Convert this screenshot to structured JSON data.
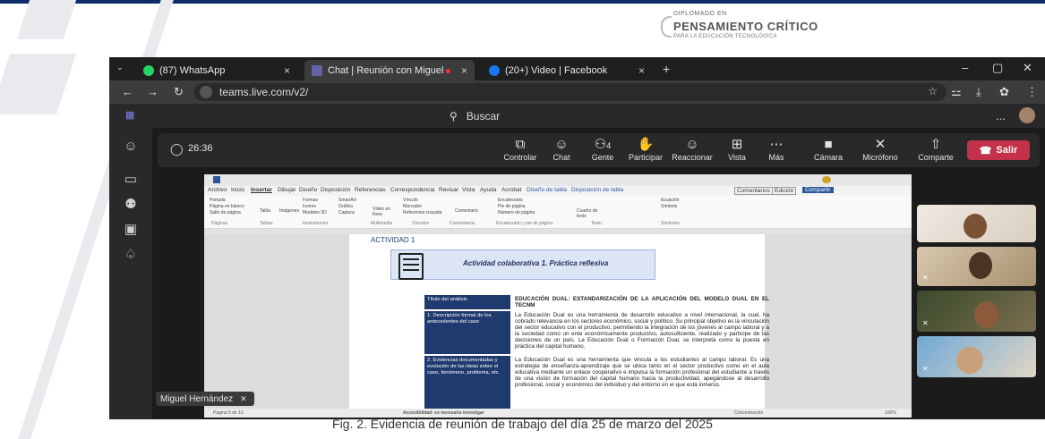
{
  "logo": {
    "small": "DIPLOMADO EN",
    "big": "PENSAMIENTO CRÍTICO",
    "sub": "PARA LA EDUCACIÓN TECNOLÓGICA"
  },
  "browser": {
    "tabs": [
      {
        "label": "(87) WhatsApp",
        "color": "#25d366"
      },
      {
        "label": "Chat | Reunión con Miguel",
        "color": "#6264a7"
      },
      {
        "label": "(20+) Video | Facebook",
        "color": "#1877f2"
      }
    ],
    "new_tab": "+",
    "url": "teams.live.com/v2/"
  },
  "teams": {
    "search_placeholder": "Buscar",
    "more": "...",
    "timer": "26:36",
    "controls": [
      {
        "label": "Controlar",
        "icon": "share-screen-icon",
        "glyph": "⧉"
      },
      {
        "label": "Chat",
        "icon": "chat-icon",
        "glyph": "☺"
      },
      {
        "label": "Gente",
        "icon": "people-icon",
        "glyph": "⚇",
        "badge": "4"
      },
      {
        "label": "Participar",
        "icon": "raise-hand-icon",
        "glyph": "✋"
      },
      {
        "label": "Reaccionar",
        "icon": "reaction-icon",
        "glyph": "☺"
      },
      {
        "label": "Vista",
        "icon": "view-icon",
        "glyph": "⊞"
      },
      {
        "label": "Más",
        "icon": "more-icon",
        "glyph": "⋯"
      },
      {
        "label": "Cámara",
        "icon": "camera-icon",
        "glyph": "■"
      },
      {
        "label": "Micrófono",
        "icon": "mic-off-icon",
        "glyph": "✕"
      },
      {
        "label": "Comparte",
        "icon": "share-icon",
        "glyph": "⇧"
      }
    ],
    "leave": "Salir",
    "presenter_name": "Miguel Hernández"
  },
  "word": {
    "menu": [
      "Archivo",
      "Inicio",
      "Insertar",
      "Dibujar",
      "Diseño",
      "Disposición",
      "Referencias",
      "Correspondencia",
      "Revisar",
      "Vista",
      "Ayuda",
      "Acrobat",
      "Diseño de tabla",
      "Disposición de tabla"
    ],
    "ribbon": [
      "Portada",
      "Página en blanco",
      "Salto de página",
      "Tabla",
      "Imágenes",
      "Formas",
      "Iconos",
      "Modelos 3D",
      "SmartArt",
      "Gráfico",
      "Captura",
      "Vídeo en línea",
      "Vínculo",
      "Marcador",
      "Referencia cruzada",
      "Comentario",
      "Encabezado",
      "Pie de página",
      "Número de página",
      "Cuadro de texto",
      "Ecuación",
      "Símbolo"
    ],
    "groups": [
      "Páginas",
      "Tablas",
      "Ilustraciones",
      "Multimedia",
      "Vínculos",
      "Comentarios",
      "Encabezado y pie de página",
      "Texto",
      "Símbolos"
    ],
    "share": "Compartir",
    "comments": "Comentarios",
    "editing": "Edición",
    "activity_label": "ACTIVIDAD 1",
    "banner": "Actividad colaborativa 1. Práctica reflexiva",
    "rows": [
      {
        "left": "Título del análisis",
        "right": "EDUCACIÓN DUAL: ESTANDARIZACIÓN DE LA APLICACIÓN DEL MODELO DUAL EN EL TECNM"
      },
      {
        "left": "1. Descripción formal de los antecedentes del caso",
        "right": "La Educación Dual es una herramienta de desarrollo educativo a nivel internacional, la cual, ha cobrado relevancia en los sectores económico, social y político. Su principal objetivo es la vinculación del sector educativo con el productivo, permitiendo la integración de los jóvenes al campo laboral y a la sociedad como un ente económicamente productivo, autosuficiente, realizado y partícipe de las decisiones de un país. La Educación Dual o Formación Dual, se interpreta como la puesta en práctica del capital humano."
      },
      {
        "left": "2. Evidencias documentadas y evolución de las ideas sobre el caso, fenómeno, problema, etc.",
        "right": "La Educación Dual es una herramienta que vincula a los estudiantes al campo laboral. Es una estrategia de enseñanza-aprendizaje que se ubica tanto en el sector productivo como en el aula educativa mediante un enlace cooperativo e impulsa la formación profesional del estudiante a través de una visión de formación del capital humano hacia la productividad, apegándose al desarrollo profesional, social y económico del individuo y del entorno en el que está inmerso."
      }
    ],
    "status_left": "Página 5 de 10",
    "status_access": "Accesibilidad: es necesario investigar",
    "status_focus": "Concentración",
    "zoom": "100%"
  },
  "caption": "Fig. 2. Evidencia de reunión de trabajo del día 25 de marzo del 2025"
}
